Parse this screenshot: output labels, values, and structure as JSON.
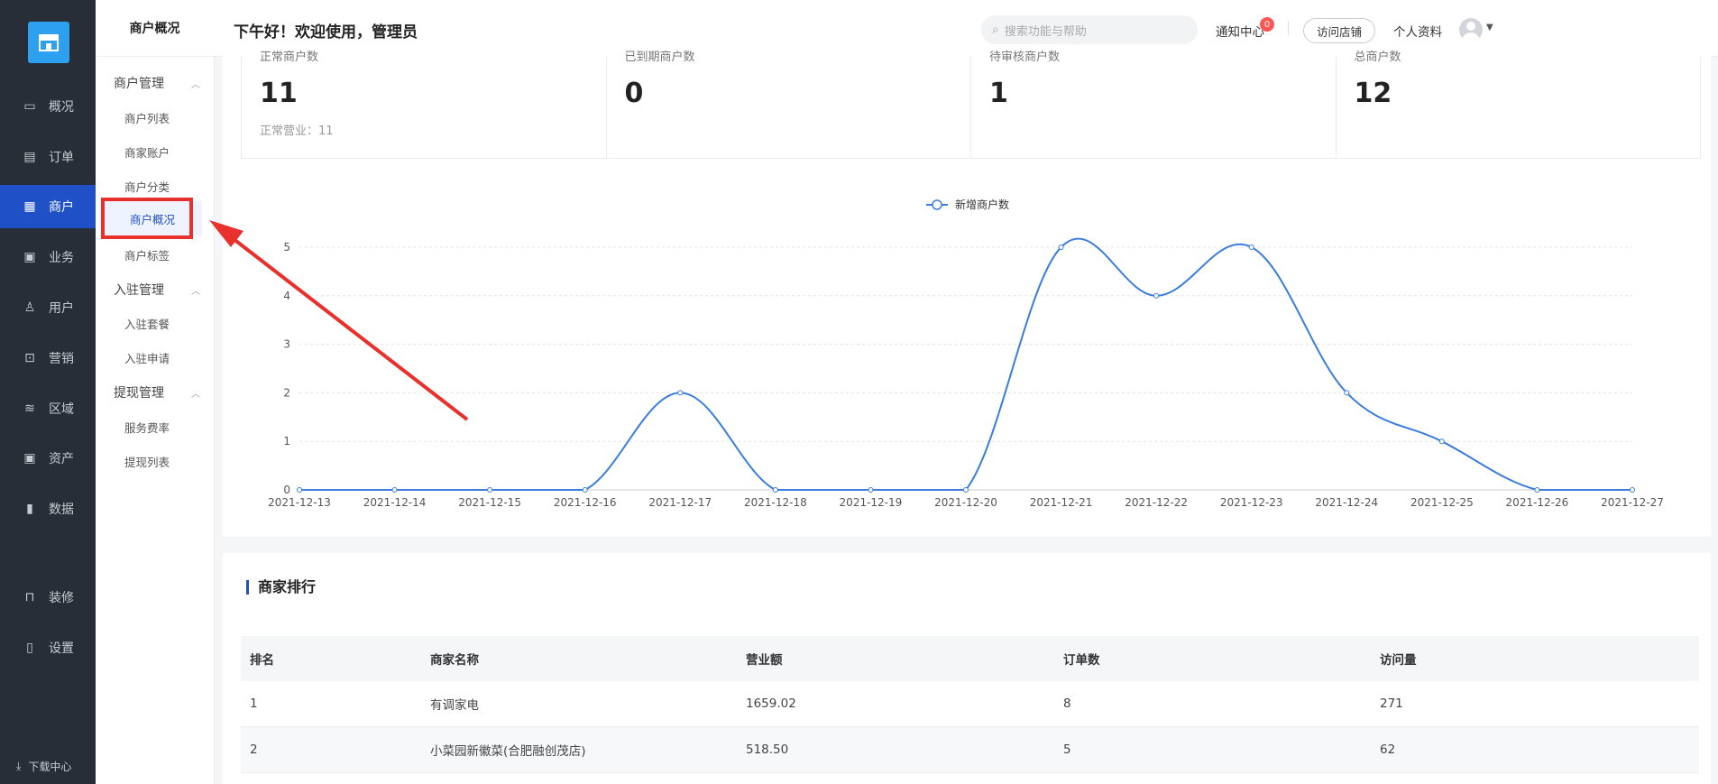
{
  "nav": {
    "items": [
      {
        "label": "概况",
        "icon": "monitor-icon"
      },
      {
        "label": "订单",
        "icon": "order-icon"
      },
      {
        "label": "商户",
        "icon": "merchant-icon"
      },
      {
        "label": "业务",
        "icon": "business-icon"
      },
      {
        "label": "用户",
        "icon": "user-icon"
      },
      {
        "label": "营销",
        "icon": "marketing-icon"
      },
      {
        "label": "区域",
        "icon": "region-icon"
      },
      {
        "label": "资产",
        "icon": "asset-icon"
      },
      {
        "label": "数据",
        "icon": "data-icon"
      },
      {
        "label": "装修",
        "icon": "decorate-icon"
      },
      {
        "label": "设置",
        "icon": "settings-icon"
      }
    ],
    "active": "商户",
    "download": "下载中心"
  },
  "subnav": {
    "title": "商户概况",
    "groups": [
      {
        "label": "商户管理",
        "items": [
          "商户列表",
          "商家账户",
          "商户分类",
          "商户概况",
          "商户标签"
        ]
      },
      {
        "label": "入驻管理",
        "items": [
          "入驻套餐",
          "入驻申请"
        ]
      },
      {
        "label": "提现管理",
        "items": [
          "服务费率",
          "提现列表"
        ]
      }
    ],
    "active": "商户概况"
  },
  "header": {
    "greeting": "下午好！欢迎使用，管理员",
    "search_placeholder": "搜索功能与帮助",
    "notice": "通知中心",
    "notice_count": "0",
    "visit": "访问店铺",
    "profile": "个人资料"
  },
  "stats": [
    {
      "label": "正常商户数",
      "value": "11",
      "extra": "正常营业：11"
    },
    {
      "label": "已到期商户数",
      "value": "0",
      "extra": ""
    },
    {
      "label": "待审核商户数",
      "value": "1",
      "extra": ""
    },
    {
      "label": "总商户数",
      "value": "12",
      "extra": ""
    }
  ],
  "chart_data": {
    "type": "line",
    "categories": [
      "2021-12-13",
      "2021-12-14",
      "2021-12-15",
      "2021-12-16",
      "2021-12-17",
      "2021-12-18",
      "2021-12-19",
      "2021-12-20",
      "2021-12-21",
      "2021-12-22",
      "2021-12-23",
      "2021-12-24",
      "2021-12-25",
      "2021-12-26",
      "2021-12-27"
    ],
    "series": [
      {
        "name": "新增商户数",
        "values": [
          0,
          0,
          0,
          0,
          2,
          0,
          0,
          0,
          5,
          4,
          5,
          2,
          1,
          0,
          0
        ]
      }
    ],
    "ylim": [
      0,
      5
    ],
    "yticks": [
      0,
      1,
      2,
      3,
      4,
      5
    ],
    "legend": "top-center",
    "grid": true,
    "color": "#3b7ddd"
  },
  "ranking": {
    "title": "商家排行",
    "columns": [
      "排名",
      "商家名称",
      "营业额",
      "订单数",
      "访问量"
    ],
    "rows": [
      [
        "1",
        "有调家电",
        "1659.02",
        "8",
        "271"
      ],
      [
        "2",
        "小菜园新徽菜(合肥融创茂店)",
        "518.50",
        "5",
        "62"
      ]
    ]
  }
}
